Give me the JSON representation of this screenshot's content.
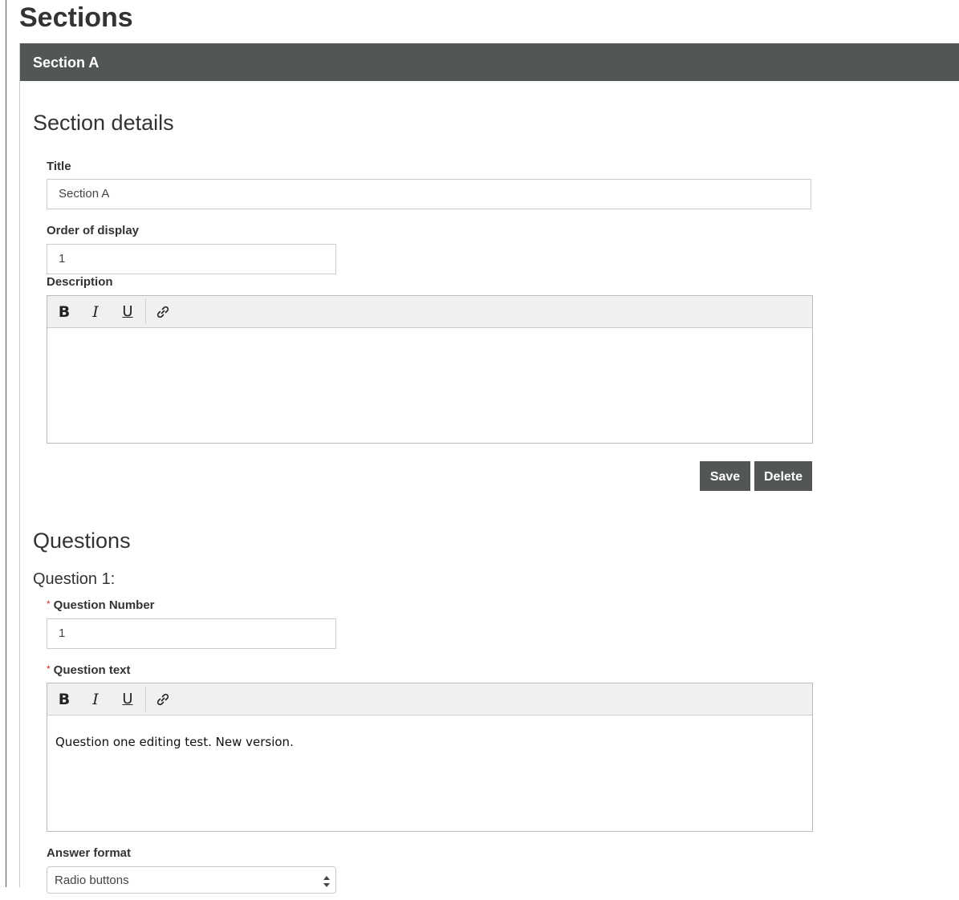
{
  "page": {
    "title": "Sections"
  },
  "section": {
    "header": "Section A",
    "details_heading": "Section details",
    "title_label": "Title",
    "title_value": "Section A",
    "order_label": "Order of display",
    "order_value": "1",
    "description_label": "Description",
    "description_value": "",
    "save_label": "Save",
    "delete_label": "Delete"
  },
  "editor_toolbar": {
    "bold": "B",
    "italic": "I",
    "underline": "U",
    "icons": [
      "bold-icon",
      "italic-icon",
      "underline-icon",
      "link-icon"
    ]
  },
  "questions": {
    "heading": "Questions",
    "items": [
      {
        "heading": "Question 1:",
        "number_label": "Question Number",
        "number_value": "1",
        "text_label": "Question text",
        "text_value": "Question one editing test. New version.",
        "answer_format_label": "Answer format",
        "answer_format_value": "Radio buttons",
        "required_marker": "*"
      }
    ]
  },
  "colors": {
    "header_bg": "#525656",
    "button_bg": "#525656",
    "required": "#c9302c"
  }
}
